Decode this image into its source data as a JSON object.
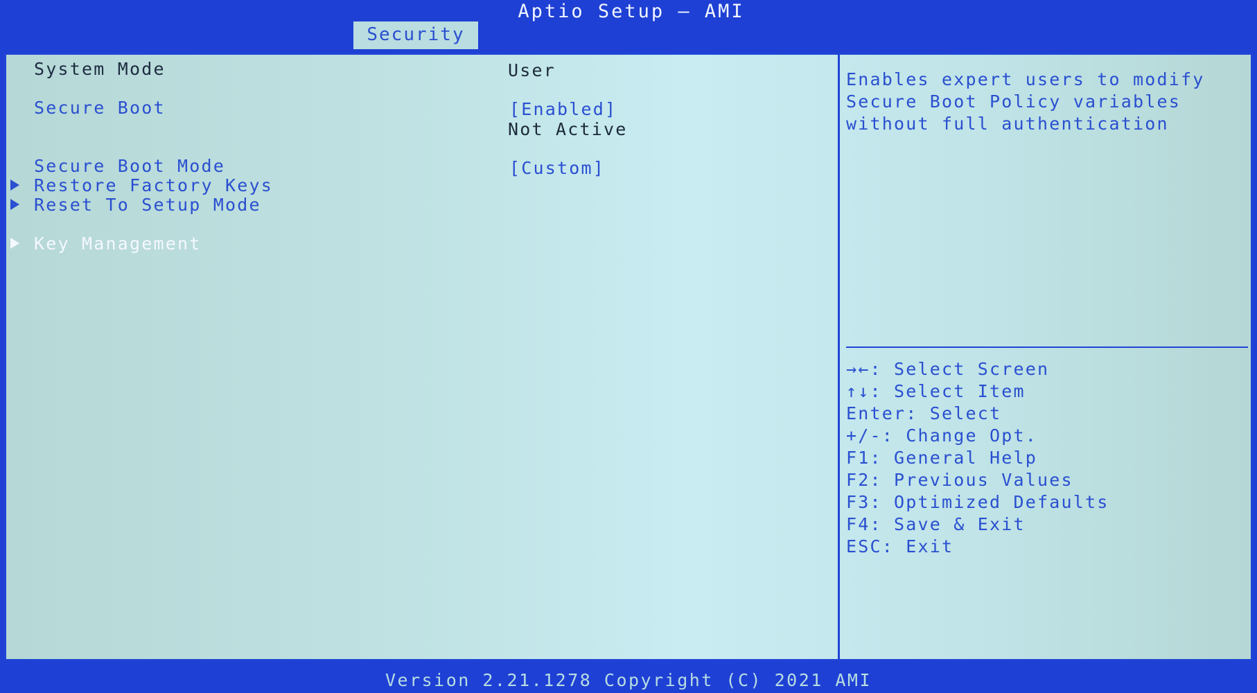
{
  "window": {
    "title": "Aptio Setup – AMI",
    "active_tab": "Security",
    "footer": "Version 2.21.1278 Copyright (C) 2021 AMI"
  },
  "settings": {
    "system_mode": {
      "label": "System Mode",
      "value": "User"
    },
    "secure_boot": {
      "label": "Secure Boot",
      "value": "[Enabled]",
      "status": "Not Active"
    },
    "secure_boot_mode": {
      "label": "Secure Boot Mode",
      "value": "[Custom]"
    },
    "restore_factory_keys": {
      "label": "Restore Factory Keys"
    },
    "reset_to_setup_mode": {
      "label": "Reset To Setup Mode"
    },
    "key_management": {
      "label": "Key Management"
    }
  },
  "help": {
    "description": "Enables expert users to modify Secure Boot Policy variables without full authentication",
    "keys": [
      "→←: Select Screen",
      "↑↓: Select Item",
      "Enter: Select",
      "+/-: Change Opt.",
      "F1: General Help",
      "F2: Previous Values",
      "F3: Optimized Defaults",
      "F4: Save & Exit",
      "ESC: Exit"
    ]
  },
  "colors": {
    "frame_blue": "#1e40d4",
    "panel_bg": "#bfe1e2",
    "link_blue": "#2a4fd0",
    "highlight_white": "#f4f8ff",
    "static_text": "#1c2c40"
  }
}
